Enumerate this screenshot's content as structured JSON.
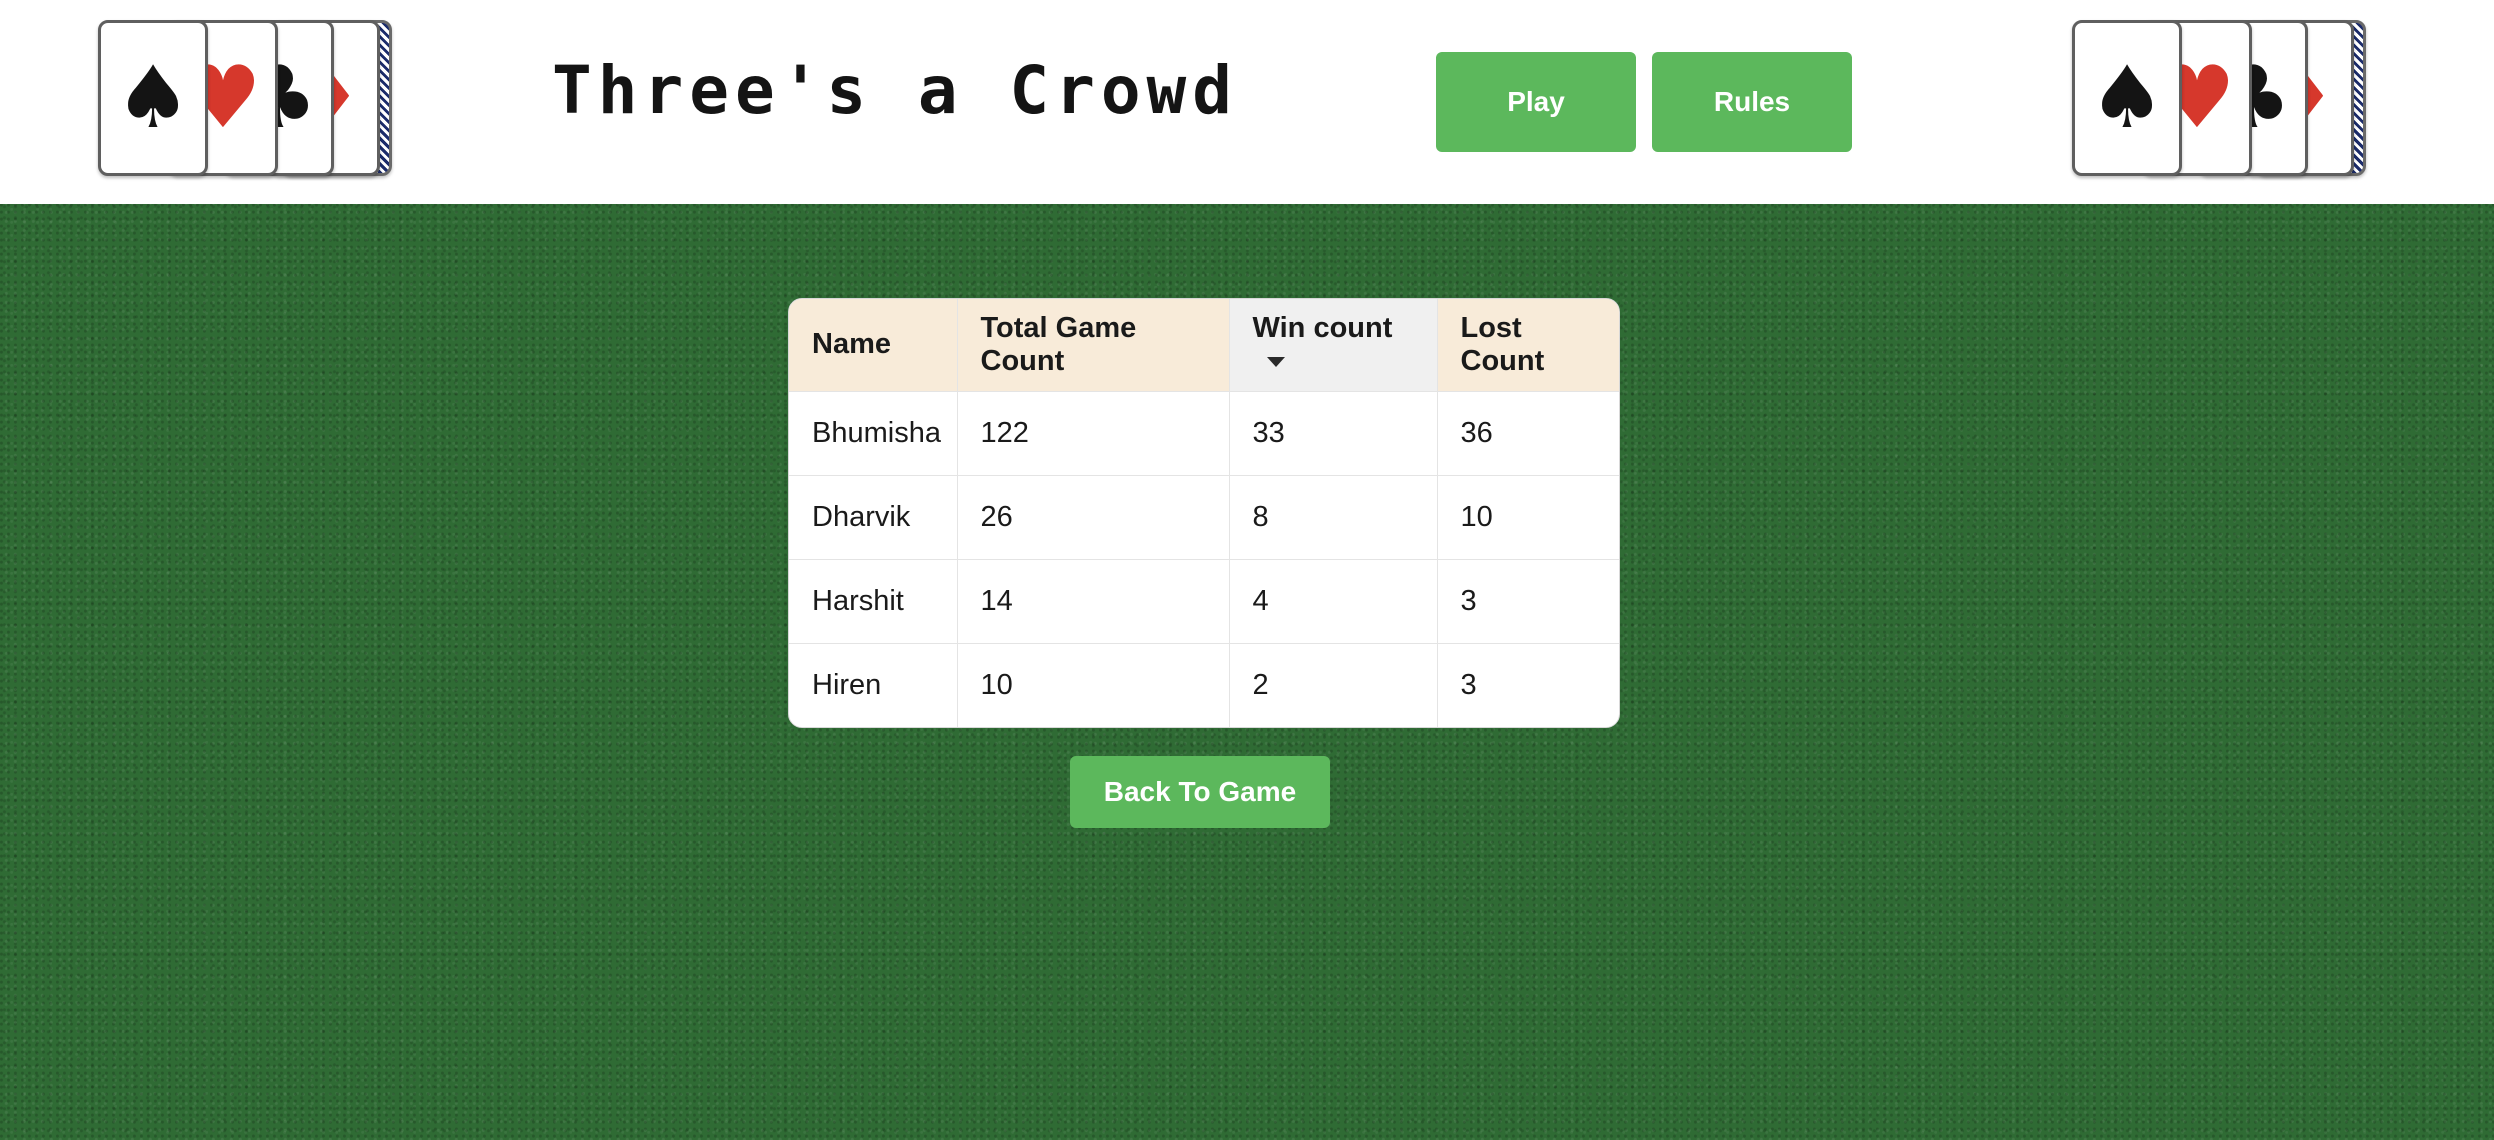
{
  "header": {
    "title": "Three's a Crowd",
    "play_label": "Play",
    "rules_label": "Rules"
  },
  "decorations": {
    "left_cards": [
      "spade-icon",
      "heart-icon",
      "club-icon",
      "diamond-icon"
    ],
    "right_cards": [
      "spade-icon",
      "heart-icon",
      "club-icon",
      "diamond-icon"
    ],
    "suits": {
      "spade": "♠",
      "heart": "♥",
      "club": "♣",
      "diamond": "♦"
    }
  },
  "leaderboard": {
    "columns": [
      "Name",
      "Total Game Count",
      "Win count",
      "Lost Count"
    ],
    "sorted_column": "Win count",
    "sort_direction": "descending",
    "rows": [
      {
        "name": "Bhumisha",
        "total": "122",
        "win": "33",
        "lost": "36"
      },
      {
        "name": "Dharvik",
        "total": "26",
        "win": "8",
        "lost": "10"
      },
      {
        "name": "Harshit",
        "total": "14",
        "win": "4",
        "lost": "3"
      },
      {
        "name": "Hiren",
        "total": "10",
        "win": "2",
        "lost": "3"
      }
    ]
  },
  "back_button_label": "Back To Game",
  "colors": {
    "accent": "#5cb85c",
    "felt": "#2f6b34",
    "header_cell": "#f8ebd9",
    "suit_red": "#d6382c",
    "suit_black": "#141414"
  }
}
